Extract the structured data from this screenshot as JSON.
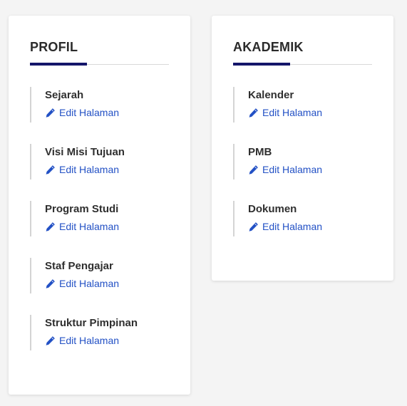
{
  "colors": {
    "accent": "#14166a",
    "link": "#2351c5"
  },
  "profil": {
    "title": "PROFIL",
    "items": [
      {
        "label": "Sejarah",
        "edit_label": "Edit Halaman"
      },
      {
        "label": "Visi Misi Tujuan",
        "edit_label": "Edit Halaman"
      },
      {
        "label": "Program Studi",
        "edit_label": "Edit Halaman"
      },
      {
        "label": "Staf Pengajar",
        "edit_label": "Edit Halaman"
      },
      {
        "label": "Struktur Pimpinan",
        "edit_label": "Edit Halaman"
      }
    ]
  },
  "akademik": {
    "title": "AKADEMIK",
    "items": [
      {
        "label": "Kalender",
        "edit_label": "Edit Halaman"
      },
      {
        "label": "PMB",
        "edit_label": "Edit Halaman"
      },
      {
        "label": "Dokumen",
        "edit_label": "Edit Halaman"
      }
    ]
  }
}
